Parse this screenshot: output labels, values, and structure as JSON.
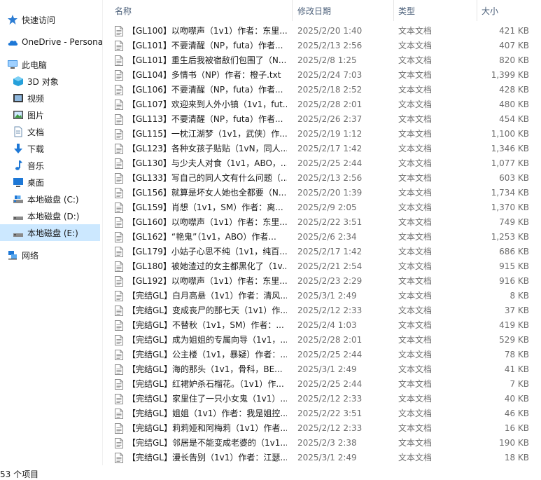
{
  "nav": {
    "items": [
      {
        "label": "快速访问",
        "icon": "star-icon"
      },
      {
        "label": "OneDrive - Persona",
        "icon": "cloud-icon"
      },
      {
        "label": "此电脑",
        "icon": "computer-icon"
      },
      {
        "label": "3D 对象",
        "icon": "cube-icon"
      },
      {
        "label": "视频",
        "icon": "video-icon"
      },
      {
        "label": "图片",
        "icon": "picture-icon"
      },
      {
        "label": "文档",
        "icon": "document-icon"
      },
      {
        "label": "下载",
        "icon": "download-icon"
      },
      {
        "label": "音乐",
        "icon": "music-icon"
      },
      {
        "label": "桌面",
        "icon": "desktop-icon"
      },
      {
        "label": "本地磁盘 (C:)",
        "icon": "drive-icon"
      },
      {
        "label": "本地磁盘 (D:)",
        "icon": "drive-icon"
      },
      {
        "label": "本地磁盘 (E:)",
        "icon": "drive-icon",
        "selected": true
      },
      {
        "label": "网络",
        "icon": "network-icon"
      }
    ]
  },
  "columns": {
    "name": "名称",
    "date": "修改日期",
    "type": "类型",
    "size": "大小"
  },
  "files": [
    {
      "name": "【GL100】以吻噤声（1v1）作者：东里...",
      "date": "2025/2/20 1:40",
      "type": "文本文档",
      "size": "421 KB"
    },
    {
      "name": "【GL101】不要清醒（NP，futa）作者...",
      "date": "2025/2/13 2:56",
      "type": "文本文档",
      "size": "407 KB"
    },
    {
      "name": "【GL101】重生后我被宿敌们包围了（N...",
      "date": "2025/2/8 1:25",
      "type": "文本文档",
      "size": "820 KB"
    },
    {
      "name": "【GL104】多情书（NP）作者：橙子.txt",
      "date": "2025/2/24 7:03",
      "type": "文本文档",
      "size": "1,399 KB"
    },
    {
      "name": "【GL106】不要清醒（NP，futa）作者...",
      "date": "2025/2/18 2:52",
      "type": "文本文档",
      "size": "428 KB"
    },
    {
      "name": "【GL107】欢迎来到人外小镇（1v1，fut...",
      "date": "2025/2/28 2:01",
      "type": "文本文档",
      "size": "480 KB"
    },
    {
      "name": "【GL113】不要清醒（NP，futa）作者...",
      "date": "2025/2/26 2:37",
      "type": "文本文档",
      "size": "454 KB"
    },
    {
      "name": "【GL115】一枕江湖梦（1v1，武侠）作...",
      "date": "2025/2/19 1:12",
      "type": "文本文档",
      "size": "1,100 KB"
    },
    {
      "name": "【GL123】各种女孩子贴贴（1vN，同人...",
      "date": "2025/2/17 1:42",
      "type": "文本文档",
      "size": "1,346 KB"
    },
    {
      "name": "【GL130】与少夫人对食（1v1，ABO，...",
      "date": "2025/2/25 2:44",
      "type": "文本文档",
      "size": "1,077 KB"
    },
    {
      "name": "【GL133】写自己的同人文有什么问题（...",
      "date": "2025/2/13 2:56",
      "type": "文本文档",
      "size": "603 KB"
    },
    {
      "name": "【GL156】就算是坏女人她也全都要（N...",
      "date": "2025/2/20 1:39",
      "type": "文本文档",
      "size": "1,734 KB"
    },
    {
      "name": "【GL159】肖想（1v1，SM）作者：离...",
      "date": "2025/2/9 2:05",
      "type": "文本文档",
      "size": "1,370 KB"
    },
    {
      "name": "【GL160】以吻噤声（1v1）作者：东里...",
      "date": "2025/2/22 3:51",
      "type": "文本文档",
      "size": "749 KB"
    },
    {
      "name": "【GL162】“艳鬼”（1v1，ABO）作者...",
      "date": "2025/2/6 2:34",
      "type": "文本文档",
      "size": "1,253 KB"
    },
    {
      "name": "【GL179】小姑子心思不纯（1v1，纯百...",
      "date": "2025/2/17 1:42",
      "type": "文本文档",
      "size": "686 KB"
    },
    {
      "name": "【GL180】被她渣过的女主都黑化了（1v...",
      "date": "2025/2/21 2:54",
      "type": "文本文档",
      "size": "915 KB"
    },
    {
      "name": "【GL192】以吻噤声（1v1）作者：东里...",
      "date": "2025/2/23 2:29",
      "type": "文本文档",
      "size": "916 KB"
    },
    {
      "name": "【完结GL】白月高悬（1v1）作者：清风...",
      "date": "2025/3/1 2:49",
      "type": "文本文档",
      "size": "8 KB"
    },
    {
      "name": "【完结GL】变成丧尸的那七天（1v1）作...",
      "date": "2025/2/12 2:33",
      "type": "文本文档",
      "size": "37 KB"
    },
    {
      "name": "【完结GL】不替秋（1v1，SM）作者：...",
      "date": "2025/2/4 1:03",
      "type": "文本文档",
      "size": "419 KB"
    },
    {
      "name": "【完结GL】成为姐姐的专属向导（1v1，...",
      "date": "2025/2/28 2:01",
      "type": "文本文档",
      "size": "529 KB"
    },
    {
      "name": "【完结GL】公主楼（1v1，暴疑）作者：...",
      "date": "2025/2/25 2:44",
      "type": "文本文档",
      "size": "78 KB"
    },
    {
      "name": "【完结GL】海的那头（1v1，骨科，BE...",
      "date": "2025/3/1 2:49",
      "type": "文本文档",
      "size": "41 KB"
    },
    {
      "name": "【完结GL】红裙妒杀石榴花。（1v1）作...",
      "date": "2025/2/25 2:44",
      "type": "文本文档",
      "size": "7 KB"
    },
    {
      "name": "【完结GL】家里住了一只小女鬼（1v1）...",
      "date": "2025/2/12 2:33",
      "type": "文本文档",
      "size": "40 KB"
    },
    {
      "name": "【完结GL】姐姐（1v1）作者：我是姐控...",
      "date": "2025/2/22 3:51",
      "type": "文本文档",
      "size": "46 KB"
    },
    {
      "name": "【完结GL】莉莉娅和阿梅莉（1v1）作者...",
      "date": "2025/2/12 2:33",
      "type": "文本文档",
      "size": "16 KB"
    },
    {
      "name": "【完结GL】邻居是不能变成老婆的（1v1...",
      "date": "2025/2/3 2:38",
      "type": "文本文档",
      "size": "190 KB"
    },
    {
      "name": "【完结GL】漫长告别（1v1）作者：江瑟...",
      "date": "2025/3/1 2:49",
      "type": "文本文档",
      "size": "18 KB"
    }
  ],
  "status": {
    "count": "53 个项目"
  },
  "colors": {
    "selection": "#cce8ff",
    "header_text": "#4c607a",
    "meta_text": "#6d6d6d"
  }
}
